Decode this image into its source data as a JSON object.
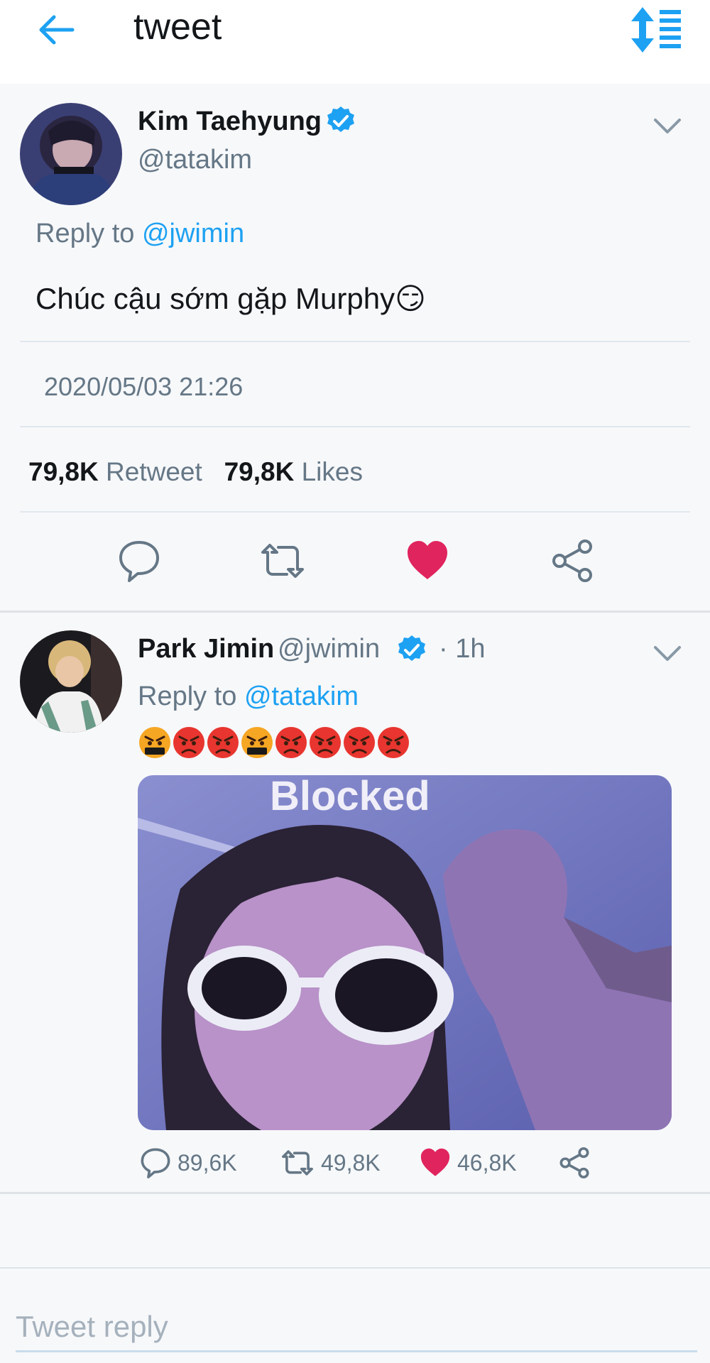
{
  "header": {
    "title": "tweet"
  },
  "main_tweet": {
    "name": "Kim Taehyung",
    "handle": "@tatakim",
    "reply_prefix": "Reply to ",
    "reply_to": "@jwimin",
    "text": "Chúc cậu sớm gặp Murphy😏",
    "timestamp": "2020/05/03 21:26",
    "retweet_count": "79,8K",
    "retweet_label": "Retweet",
    "likes_count": "79,8K",
    "likes_label": "Likes"
  },
  "reply_tweet": {
    "name": "Park Jimin",
    "handle": "@jwimin",
    "time": "· 1h",
    "reply_prefix": "Reply to ",
    "reply_to": "@tatakim",
    "emojis": [
      "face-with-symbols-emoji",
      "angry-face-emoji",
      "angry-face-emoji",
      "face-with-symbols-emoji",
      "angry-face-emoji",
      "angry-face-emoji",
      "angry-face-emoji",
      "angry-face-emoji"
    ],
    "media_caption": "Blocked",
    "reply_count": "89,6K",
    "retweet_count": "49,8K",
    "like_count": "46,8K"
  },
  "reply_box": {
    "placeholder": "Tweet reply"
  },
  "colors": {
    "accent": "#1da1f2",
    "like": "#e0245e",
    "text_secondary": "#657786"
  }
}
